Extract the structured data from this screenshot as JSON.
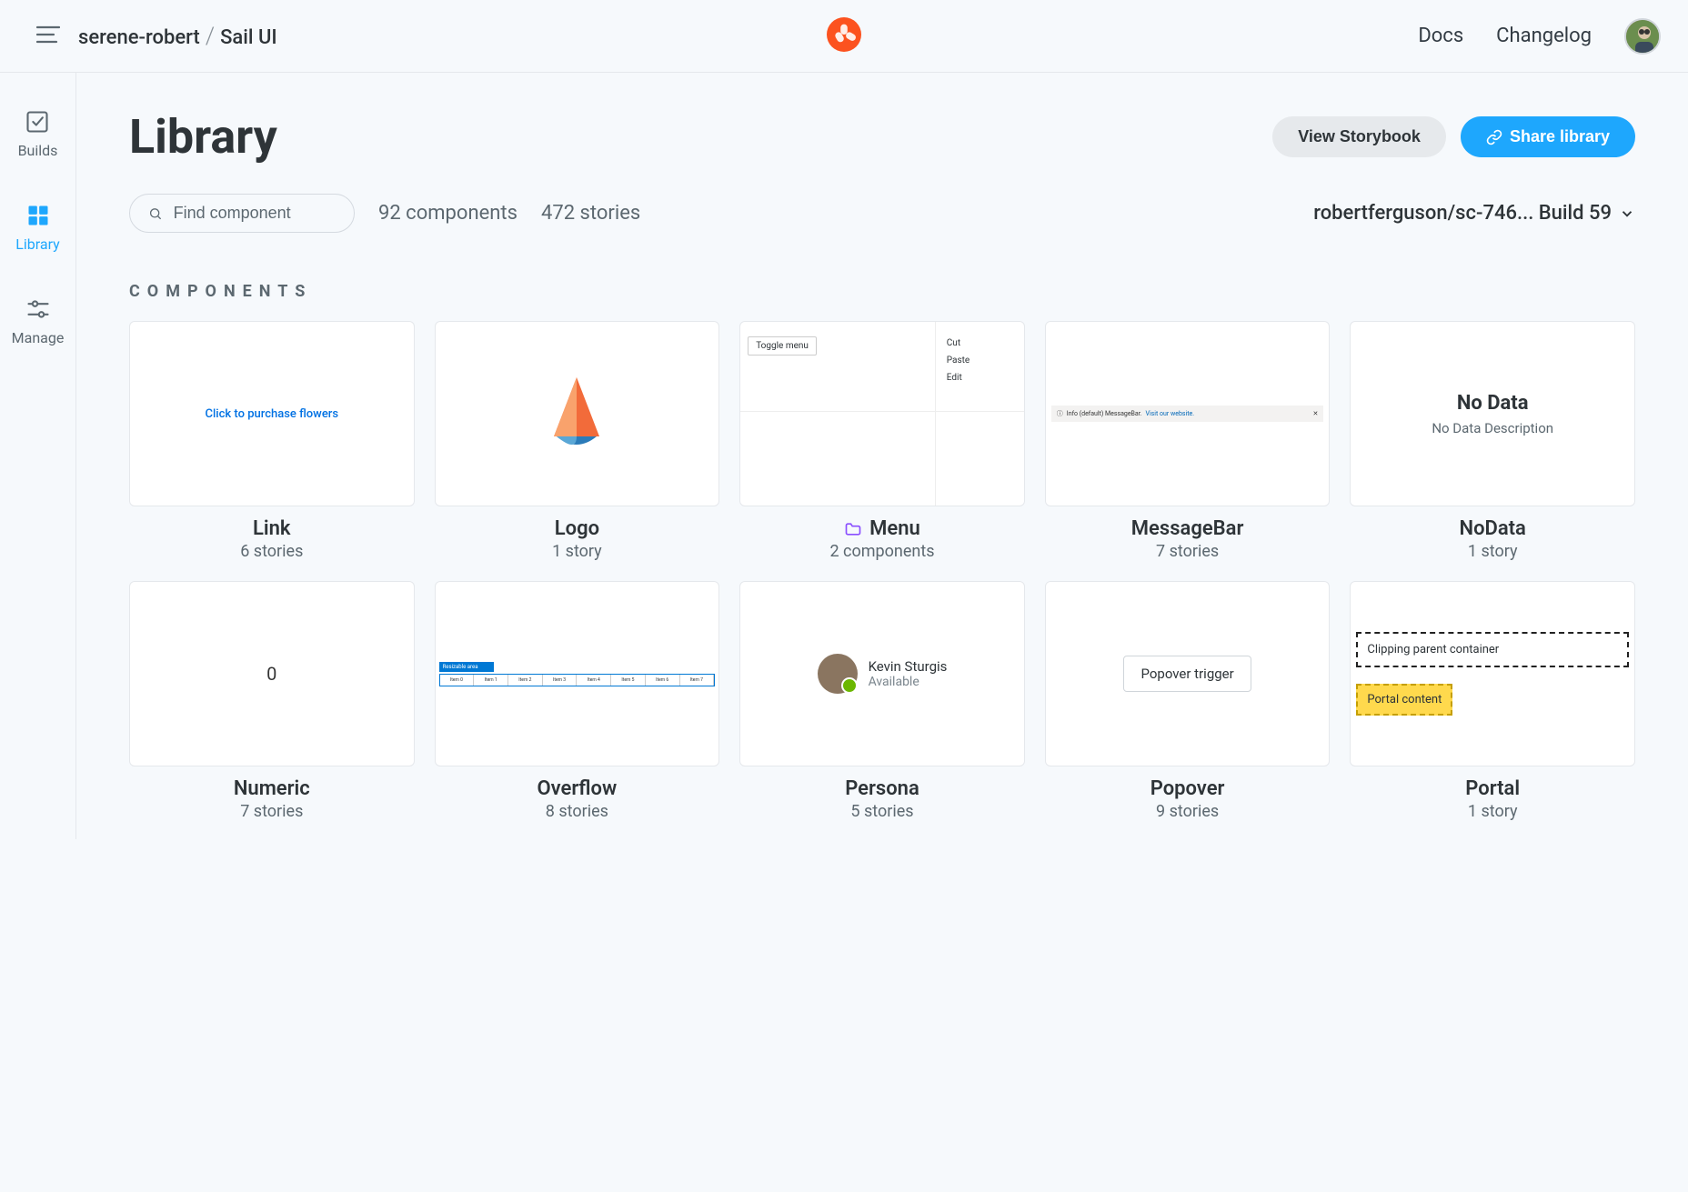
{
  "header": {
    "breadcrumb_owner": "serene-robert",
    "breadcrumb_project": "Sail UI",
    "nav": {
      "docs": "Docs",
      "changelog": "Changelog"
    }
  },
  "sidebar": {
    "items": [
      {
        "label": "Builds"
      },
      {
        "label": "Library"
      },
      {
        "label": "Manage"
      }
    ]
  },
  "page": {
    "title": "Library",
    "actions": {
      "view_storybook": "View Storybook",
      "share_library": "Share library"
    },
    "search_placeholder": "Find component",
    "stats": {
      "components": "92 components",
      "stories": "472 stories"
    },
    "branch_label": "robertferguson/sc-746... Build 59",
    "section_heading": "COMPONENTS"
  },
  "components": [
    {
      "name": "Link",
      "sub": "6 stories",
      "preview": {
        "text": "Click to purchase flowers"
      }
    },
    {
      "name": "Logo",
      "sub": "1 story"
    },
    {
      "name": "Menu",
      "sub": "2 components",
      "is_folder": true,
      "preview": {
        "button": "Toggle menu",
        "items": [
          "Cut",
          "Paste",
          "Edit"
        ]
      }
    },
    {
      "name": "MessageBar",
      "sub": "7 stories",
      "preview": {
        "text": "Info (default) MessageBar.",
        "link": "Visit our website."
      }
    },
    {
      "name": "NoData",
      "sub": "1 story",
      "preview": {
        "title": "No Data",
        "desc": "No Data Description"
      }
    },
    {
      "name": "Numeric",
      "sub": "7 stories",
      "preview": {
        "value": "0"
      }
    },
    {
      "name": "Overflow",
      "sub": "8 stories",
      "preview": {
        "heading": "Resizable area",
        "items": [
          "Item 0",
          "Item 1",
          "Item 2",
          "Item 3",
          "Item 4",
          "Item 5",
          "Item 6",
          "Item 7"
        ]
      }
    },
    {
      "name": "Persona",
      "sub": "5 stories",
      "preview": {
        "name": "Kevin Sturgis",
        "status": "Available"
      }
    },
    {
      "name": "Popover",
      "sub": "9 stories",
      "preview": {
        "button": "Popover trigger"
      }
    },
    {
      "name": "Portal",
      "sub": "1 story",
      "preview": {
        "top": "Clipping parent container",
        "bottom": "Portal content"
      }
    }
  ]
}
